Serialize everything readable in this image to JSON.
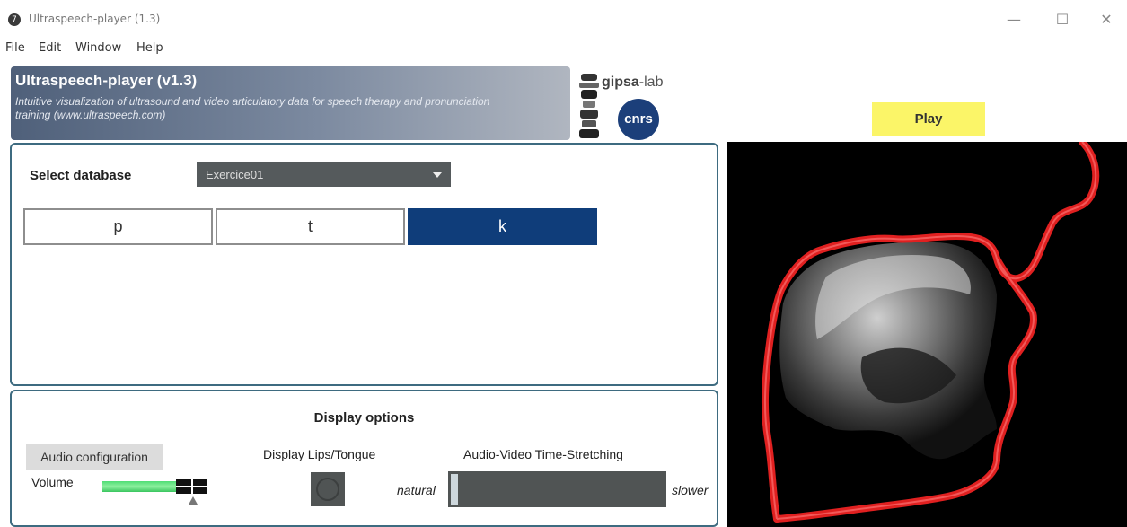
{
  "window": {
    "title": "Ultraspeech-player (1.3)",
    "app_icon_glyph": "7",
    "minimize_glyph": "—",
    "maximize_glyph": "☐",
    "close_glyph": "✕"
  },
  "menu": [
    "File",
    "Edit",
    "Window",
    "Help"
  ],
  "header": {
    "title": "Ultraspeech-player (v1.3)",
    "subtitle": "Intuitive visualization of ultrasound and video articulatory data for speech therapy and pronunciation training (www.ultraspeech.com)"
  },
  "logos": {
    "gipsa_bold": "gipsa",
    "gipsa_rest": "-lab",
    "cnrs": "cnrs"
  },
  "play_label": "Play",
  "database": {
    "label": "Select database",
    "selected": "Exercice01"
  },
  "phonemes": [
    {
      "label": "p",
      "active": false
    },
    {
      "label": "t",
      "active": false
    },
    {
      "label": "k",
      "active": true
    }
  ],
  "display_options": {
    "title": "Display options",
    "audio_config_label": "Audio configuration",
    "volume_label": "Volume",
    "volume_level": 0.72,
    "lips_tongue_label": "Display Lips/Tongue",
    "time_stretch_label": "Audio-Video Time-Stretching",
    "natural_label": "natural",
    "slower_label": "slower",
    "time_stretch_value": 0.0
  },
  "colors": {
    "accent_active": "#0f3d7a",
    "play_bg": "#fbf568",
    "panel_border": "#3e6b80",
    "contour": "#e02020"
  }
}
